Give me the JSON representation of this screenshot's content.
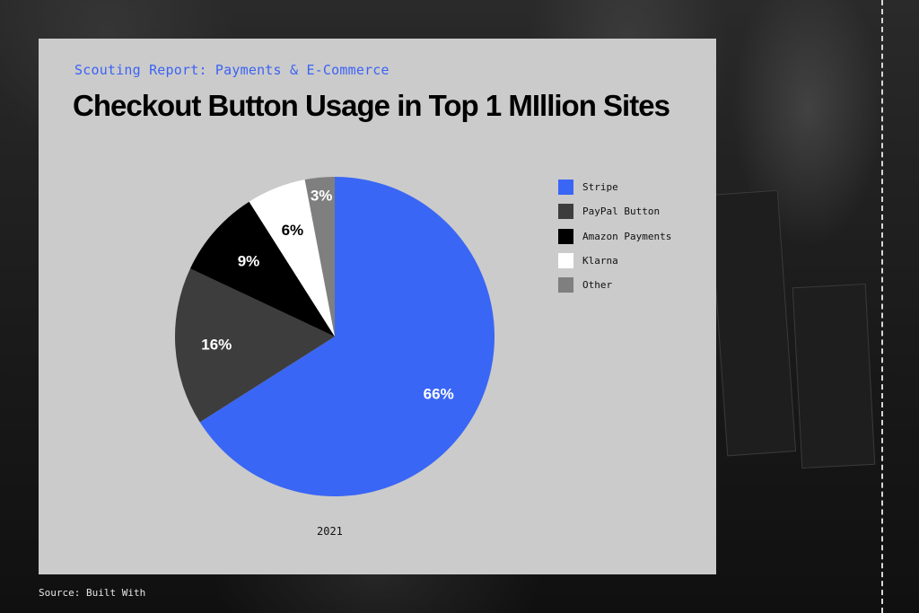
{
  "header": {
    "subtitle": "Scouting Report: Payments & E-Commerce",
    "title": "Checkout Button Usage in Top 1 MIllion Sites"
  },
  "footer": {
    "source": "Source: Built With"
  },
  "chart_data": {
    "type": "pie",
    "title": "Checkout Button Usage in Top 1 MIllion Sites",
    "xlabel": "2021",
    "legend_position": "right",
    "slices": [
      {
        "label": "Stripe",
        "value": 66,
        "display": "66%",
        "color": "#3a66f5",
        "text_color": "#ffffff"
      },
      {
        "label": "PayPal Button",
        "value": 16,
        "display": "16%",
        "color": "#3d3d3d",
        "text_color": "#ffffff"
      },
      {
        "label": "Amazon Payments",
        "value": 9,
        "display": "9%",
        "color": "#000000",
        "text_color": "#ffffff"
      },
      {
        "label": "Klarna",
        "value": 6,
        "display": "6%",
        "color": "#ffffff",
        "text_color": "#000000"
      },
      {
        "label": "Other",
        "value": 3,
        "display": "3%",
        "color": "#7f7f7f",
        "text_color": "#ffffff"
      }
    ]
  }
}
